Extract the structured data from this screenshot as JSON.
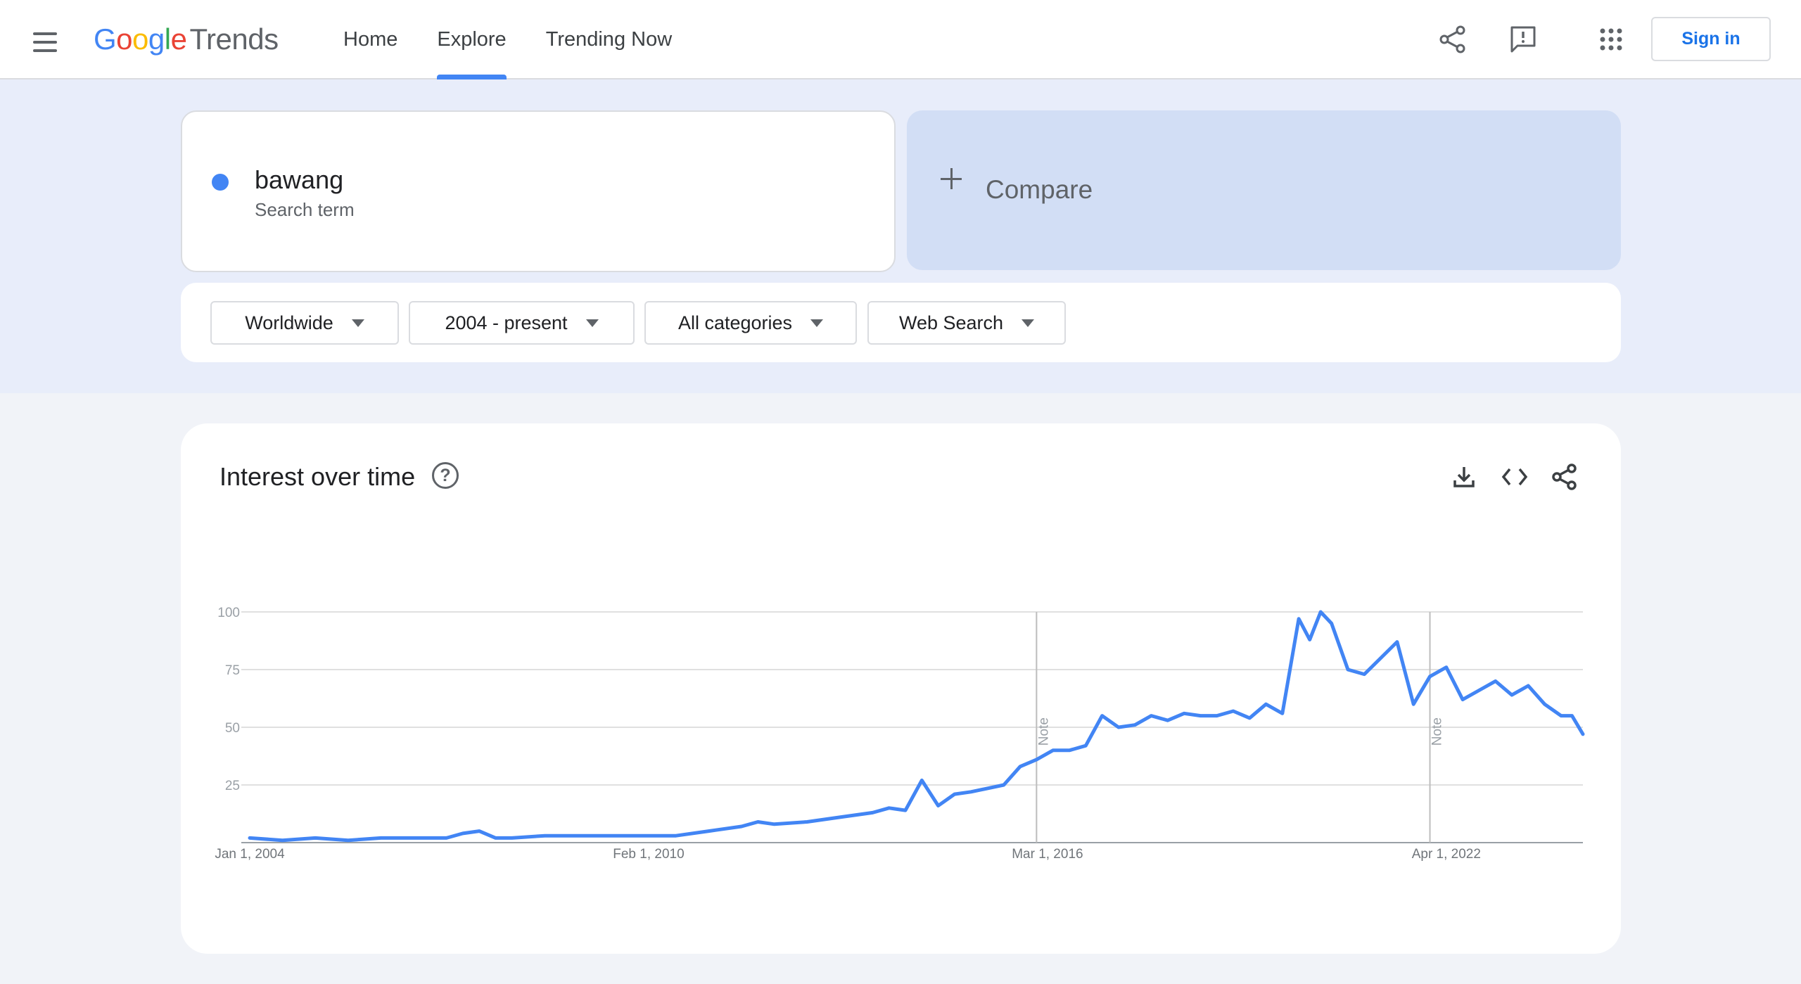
{
  "header": {
    "logo": {
      "g1": "G",
      "o1": "o",
      "o2": "o",
      "g2": "g",
      "l": "l",
      "e": "e",
      "product": "Trends"
    },
    "nav": [
      {
        "label": "Home",
        "active": false
      },
      {
        "label": "Explore",
        "active": true
      },
      {
        "label": "Trending Now",
        "active": false
      }
    ],
    "icons": [
      "menu-icon",
      "share-icon",
      "feedback-icon",
      "apps-grid-icon"
    ],
    "sign_in_label": "Sign in"
  },
  "search": {
    "term": "bawang",
    "term_type": "Search term",
    "term_color": "#4285f4",
    "compare_label": "Compare"
  },
  "filters": {
    "region": "Worldwide",
    "time_range": "2004 - present",
    "category": "All categories",
    "search_type": "Web Search"
  },
  "chart_card": {
    "title": "Interest over time",
    "help_icon": "help-circle-icon",
    "action_icons": [
      "download-icon",
      "embed-code-icon",
      "share-icon"
    ]
  },
  "chart_data": {
    "type": "line",
    "title": "Interest over time",
    "xlabel": "",
    "ylabel": "",
    "ylim": [
      0,
      100
    ],
    "y_ticks": [
      25,
      50,
      75,
      100
    ],
    "x_tick_labels": [
      "Jan 1, 2004",
      "Feb 1, 2010",
      "Mar 1, 2016",
      "Apr 1, 2022"
    ],
    "x_range": [
      "2004-01",
      "2024-05"
    ],
    "grid": true,
    "legend": "none",
    "series_color": "#4285f4",
    "notes": [
      {
        "date": "2016-01",
        "label": "Note"
      },
      {
        "date": "2022-01",
        "label": "Note"
      }
    ],
    "series": [
      {
        "name": "bawang",
        "points": [
          [
            "2004-01",
            2
          ],
          [
            "2004-07",
            1
          ],
          [
            "2005-01",
            2
          ],
          [
            "2005-07",
            1
          ],
          [
            "2006-01",
            2
          ],
          [
            "2006-07",
            2
          ],
          [
            "2007-01",
            2
          ],
          [
            "2007-04",
            4
          ],
          [
            "2007-07",
            5
          ],
          [
            "2007-10",
            2
          ],
          [
            "2008-01",
            2
          ],
          [
            "2008-07",
            3
          ],
          [
            "2009-01",
            3
          ],
          [
            "2009-07",
            3
          ],
          [
            "2010-01",
            3
          ],
          [
            "2010-07",
            3
          ],
          [
            "2011-01",
            5
          ],
          [
            "2011-07",
            7
          ],
          [
            "2011-10",
            9
          ],
          [
            "2012-01",
            8
          ],
          [
            "2012-07",
            9
          ],
          [
            "2013-01",
            11
          ],
          [
            "2013-07",
            13
          ],
          [
            "2013-10",
            15
          ],
          [
            "2014-01",
            14
          ],
          [
            "2014-04",
            27
          ],
          [
            "2014-07",
            16
          ],
          [
            "2014-10",
            21
          ],
          [
            "2015-01",
            22
          ],
          [
            "2015-07",
            25
          ],
          [
            "2015-10",
            33
          ],
          [
            "2016-01",
            36
          ],
          [
            "2016-04",
            40
          ],
          [
            "2016-07",
            40
          ],
          [
            "2016-10",
            42
          ],
          [
            "2017-01",
            55
          ],
          [
            "2017-04",
            50
          ],
          [
            "2017-07",
            51
          ],
          [
            "2017-10",
            55
          ],
          [
            "2018-01",
            53
          ],
          [
            "2018-04",
            56
          ],
          [
            "2018-07",
            55
          ],
          [
            "2018-10",
            55
          ],
          [
            "2019-01",
            57
          ],
          [
            "2019-04",
            54
          ],
          [
            "2019-07",
            60
          ],
          [
            "2019-10",
            56
          ],
          [
            "2020-01",
            97
          ],
          [
            "2020-03",
            88
          ],
          [
            "2020-05",
            100
          ],
          [
            "2020-07",
            95
          ],
          [
            "2020-10",
            75
          ],
          [
            "2021-01",
            73
          ],
          [
            "2021-04",
            80
          ],
          [
            "2021-07",
            87
          ],
          [
            "2021-10",
            60
          ],
          [
            "2022-01",
            72
          ],
          [
            "2022-04",
            76
          ],
          [
            "2022-07",
            62
          ],
          [
            "2022-10",
            66
          ],
          [
            "2023-01",
            70
          ],
          [
            "2023-04",
            64
          ],
          [
            "2023-07",
            68
          ],
          [
            "2023-10",
            60
          ],
          [
            "2024-01",
            55
          ],
          [
            "2024-03",
            55
          ],
          [
            "2024-05",
            47
          ]
        ]
      }
    ]
  }
}
